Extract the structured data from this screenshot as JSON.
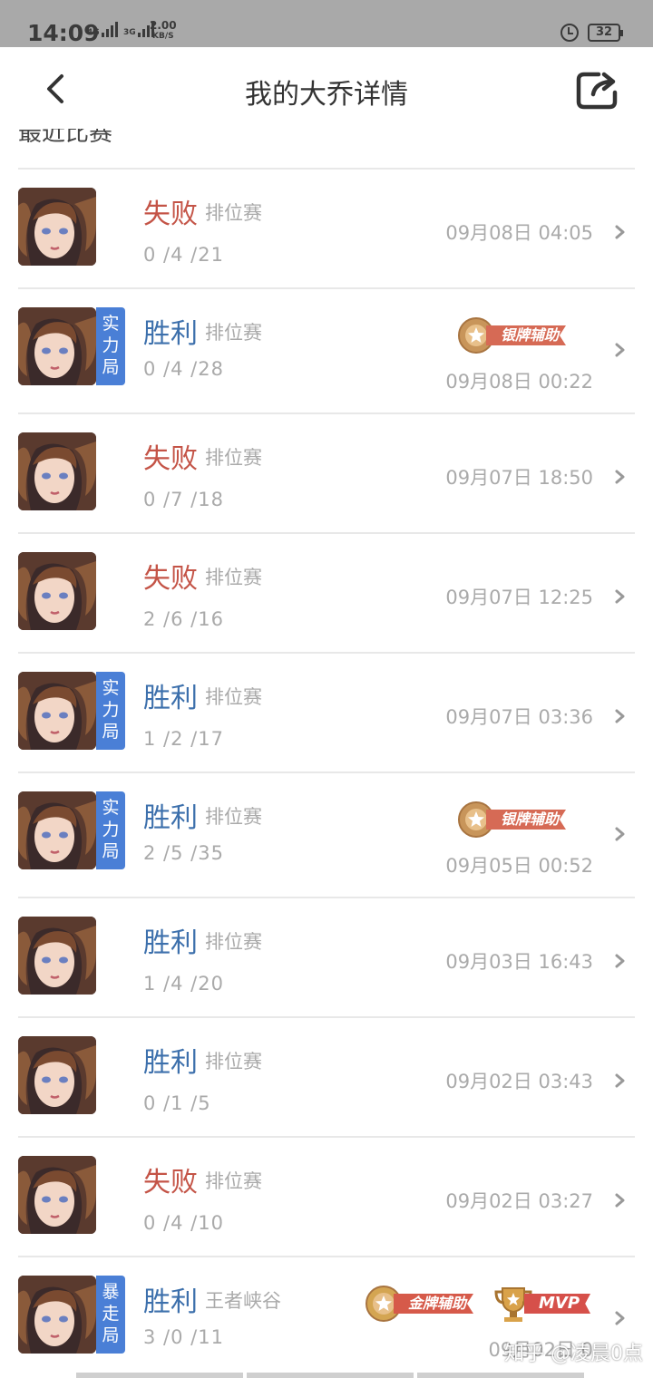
{
  "status_bar": {
    "time": "14:09",
    "signal_1": "4G",
    "signal_2": "3G",
    "net_speed": "2.00",
    "net_speed_unit": "KB/S",
    "battery": "32"
  },
  "nav": {
    "title": "我的大乔详情",
    "back_icon": "chevron-left-icon",
    "share_icon": "share-icon"
  },
  "section": {
    "title": "最近比赛"
  },
  "colors": {
    "win": "#3d70ac",
    "loss": "#c45447",
    "badge_bg": "#4a7fd6",
    "meta_gray": "#aaaaaa"
  },
  "matches": [
    {
      "result": "失败",
      "type": "排位赛",
      "kda": "0 /4 /21",
      "time": "09月08日 04:05",
      "badge": "",
      "medals": []
    },
    {
      "result": "胜利",
      "type": "排位赛",
      "kda": "0 /4 /28",
      "time": "09月08日 00:22",
      "badge": "实力局",
      "medals": [
        "银牌辅助"
      ]
    },
    {
      "result": "失败",
      "type": "排位赛",
      "kda": "0 /7 /18",
      "time": "09月07日 18:50",
      "badge": "",
      "medals": []
    },
    {
      "result": "失败",
      "type": "排位赛",
      "kda": "2 /6 /16",
      "time": "09月07日 12:25",
      "badge": "",
      "medals": []
    },
    {
      "result": "胜利",
      "type": "排位赛",
      "kda": "1 /2 /17",
      "time": "09月07日 03:36",
      "badge": "实力局",
      "medals": []
    },
    {
      "result": "胜利",
      "type": "排位赛",
      "kda": "2 /5 /35",
      "time": "09月05日 00:52",
      "badge": "实力局",
      "medals": [
        "银牌辅助"
      ]
    },
    {
      "result": "胜利",
      "type": "排位赛",
      "kda": "1 /4 /20",
      "time": "09月03日 16:43",
      "badge": "",
      "medals": []
    },
    {
      "result": "胜利",
      "type": "排位赛",
      "kda": "0 /1 /5",
      "time": "09月02日 03:43",
      "badge": "",
      "medals": []
    },
    {
      "result": "失败",
      "type": "排位赛",
      "kda": "0 /4 /10",
      "time": "09月02日 03:27",
      "badge": "",
      "medals": []
    },
    {
      "result": "胜利",
      "type": "王者峡谷",
      "kda": "3 /0 /11",
      "time": "09月02日 0",
      "badge": "暴走局",
      "medals": [
        "金牌辅助",
        "MVP"
      ]
    }
  ],
  "watermark": "知乎 @凌晨0点"
}
